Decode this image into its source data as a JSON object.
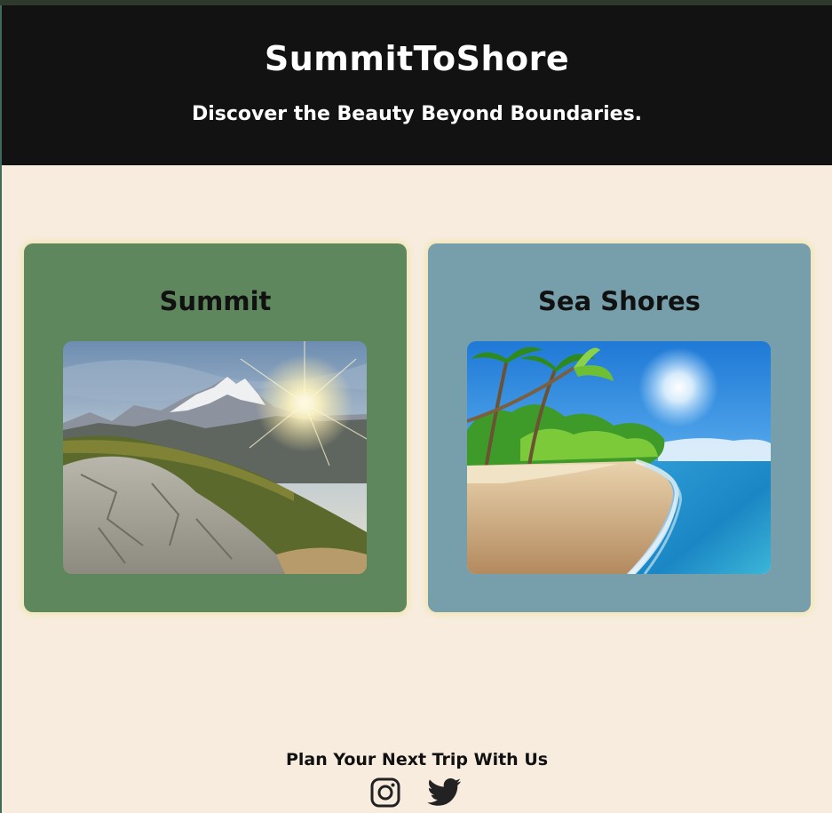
{
  "header": {
    "title": "SummitToShore",
    "tagline": "Discover the Beauty Beyond Boundaries."
  },
  "cards": [
    {
      "title": "Summit",
      "image": "mountain-sunset-photo"
    },
    {
      "title": "Sea Shores",
      "image": "tropical-beach-photo"
    }
  ],
  "footer": {
    "text": "Plan Your Next Trip With Us",
    "social": [
      {
        "icon": "instagram-icon"
      },
      {
        "icon": "twitter-icon"
      }
    ]
  },
  "colors": {
    "header_bg": "#121212",
    "page_bg": "#f7ecdd",
    "summit_card": "#5e875d",
    "shores_card": "#769fab"
  }
}
